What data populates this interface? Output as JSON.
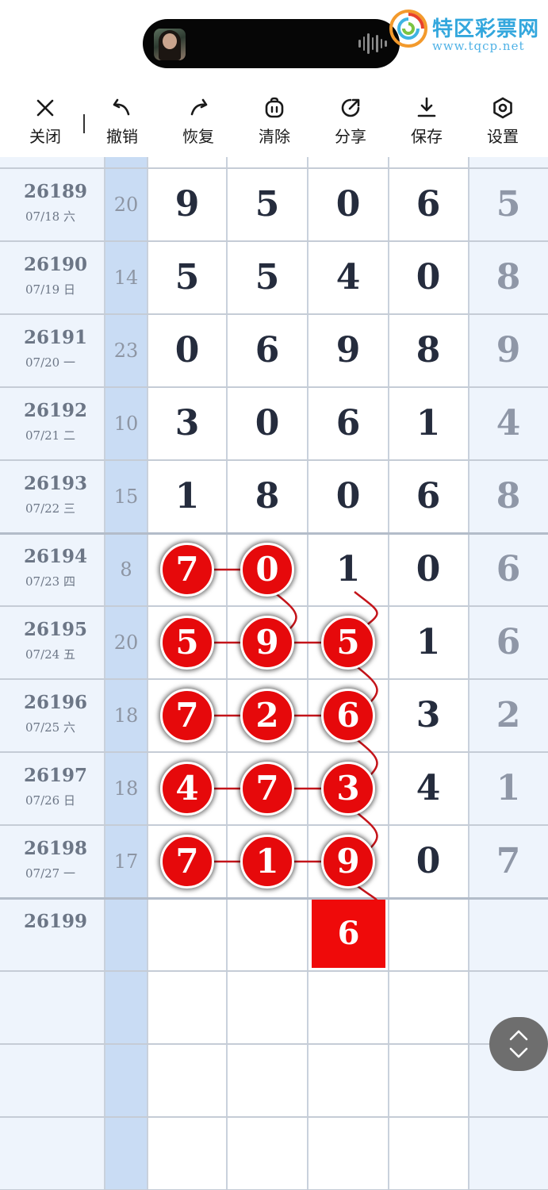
{
  "logo": {
    "name": "特区彩票网",
    "url": "www.tqcp.net"
  },
  "toolbar": {
    "close": "关闭",
    "undo": "撤销",
    "redo": "恢复",
    "clear": "清除",
    "share": "分享",
    "save": "保存",
    "settings": "设置"
  },
  "rows": [
    {
      "issue": "26189",
      "date": "07/18 六",
      "sum": "20",
      "digits": [
        "9",
        "5",
        "0",
        "6",
        "5"
      ]
    },
    {
      "issue": "26190",
      "date": "07/19 日",
      "sum": "14",
      "digits": [
        "5",
        "5",
        "4",
        "0",
        "8"
      ]
    },
    {
      "issue": "26191",
      "date": "07/20 一",
      "sum": "23",
      "digits": [
        "0",
        "6",
        "9",
        "8",
        "9"
      ]
    },
    {
      "issue": "26192",
      "date": "07/21 二",
      "sum": "10",
      "digits": [
        "3",
        "0",
        "6",
        "1",
        "4"
      ]
    },
    {
      "issue": "26193",
      "date": "07/22 三",
      "sum": "15",
      "digits": [
        "1",
        "8",
        "0",
        "6",
        "8"
      ]
    },
    {
      "issue": "26194",
      "date": "07/23 四",
      "sum": "8",
      "digits": [
        "7",
        "0",
        "1",
        "0",
        "6"
      ]
    },
    {
      "issue": "26195",
      "date": "07/24 五",
      "sum": "20",
      "digits": [
        "5",
        "9",
        "5",
        "1",
        "6"
      ]
    },
    {
      "issue": "26196",
      "date": "07/25 六",
      "sum": "18",
      "digits": [
        "7",
        "2",
        "6",
        "3",
        "2"
      ]
    },
    {
      "issue": "26197",
      "date": "07/26 日",
      "sum": "18",
      "digits": [
        "4",
        "7",
        "3",
        "4",
        "1"
      ]
    },
    {
      "issue": "26198",
      "date": "07/27 一",
      "sum": "17",
      "digits": [
        "7",
        "1",
        "9",
        "0",
        "7"
      ]
    },
    {
      "issue": "26199",
      "date": "",
      "sum": "",
      "digits": [
        "",
        "",
        "",
        "",
        ""
      ]
    }
  ],
  "prediction": {
    "value": "6"
  },
  "colors": {
    "ball": "#e6090b",
    "link": "#c4141a",
    "sum_column": "#c9dcf4",
    "issue_column": "#eef4fc"
  }
}
